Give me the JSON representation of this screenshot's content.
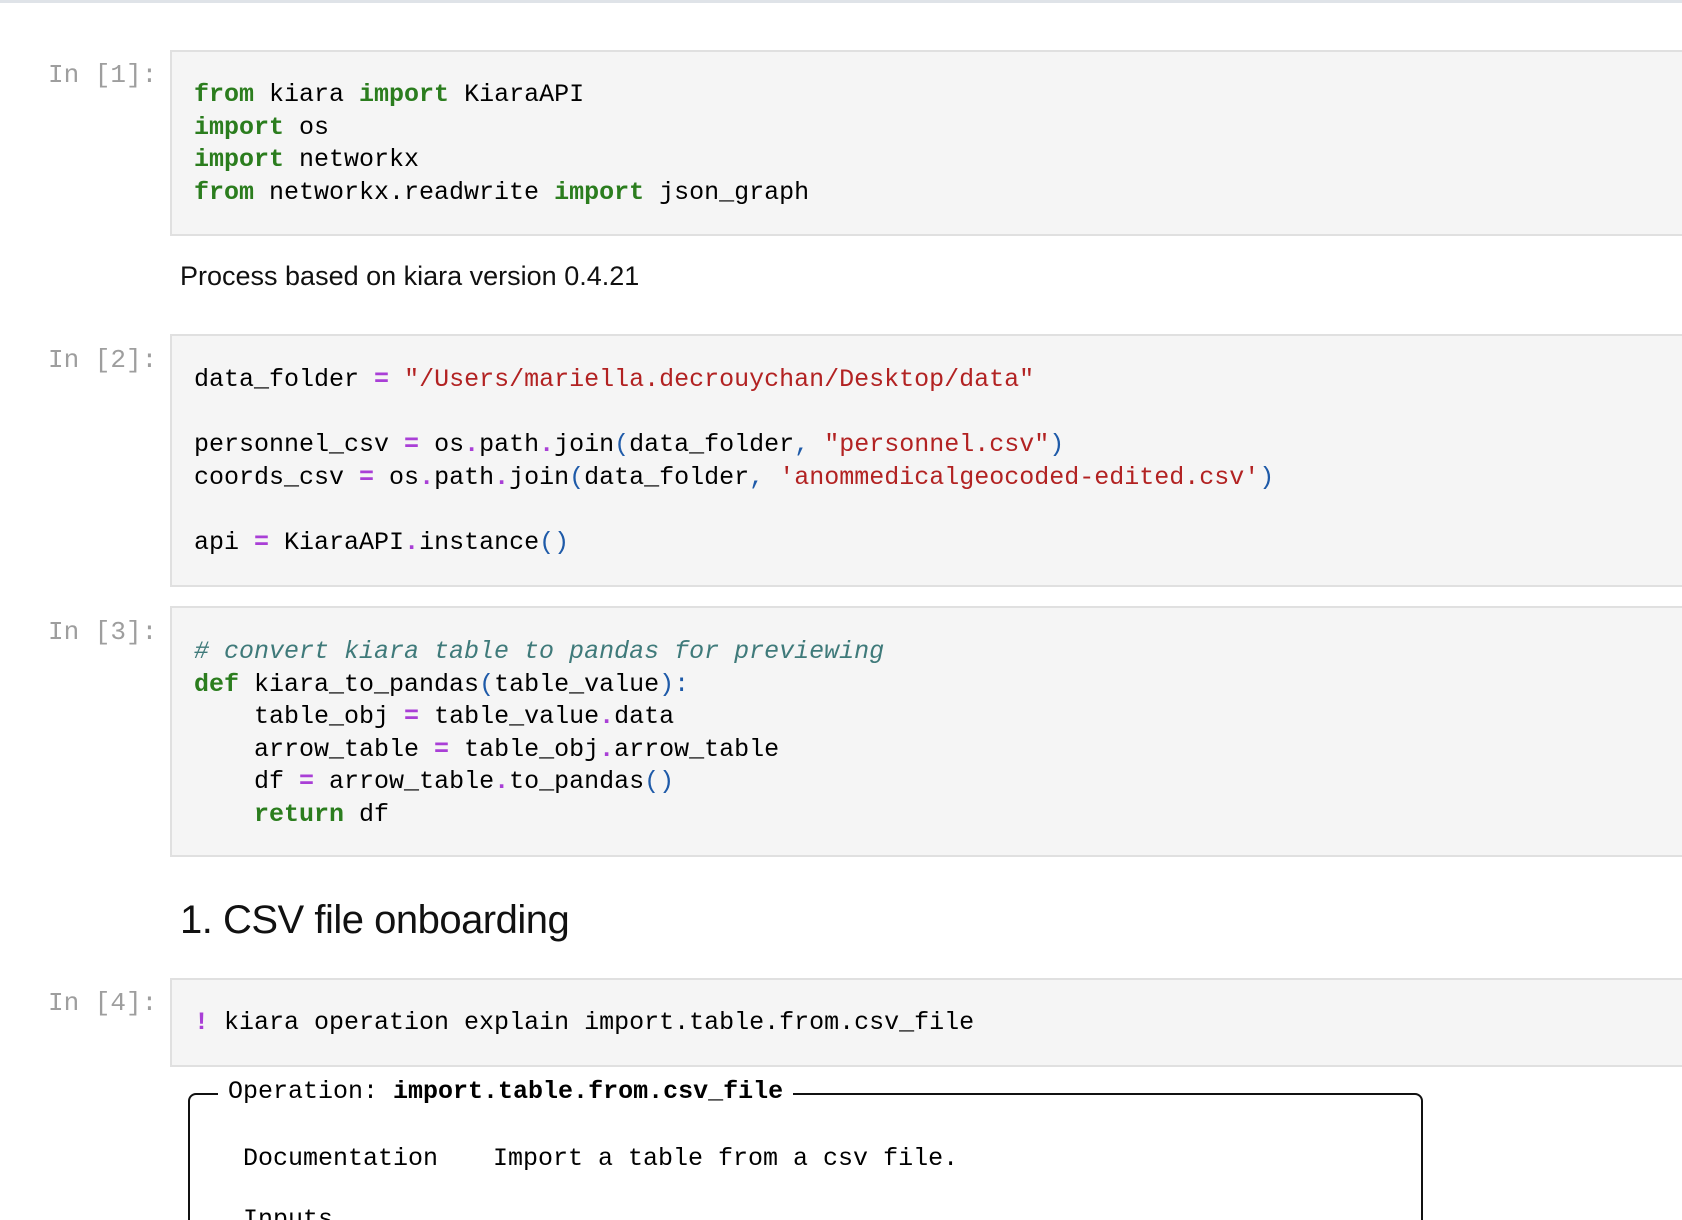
{
  "cells": [
    {
      "prompt": "In [1]:",
      "lines": [
        [
          [
            "kw",
            "from"
          ],
          [
            "t",
            " kiara "
          ],
          [
            "kw",
            "import"
          ],
          [
            "t",
            " KiaraAPI"
          ]
        ],
        [
          [
            "kw",
            "import"
          ],
          [
            "t",
            " os"
          ]
        ],
        [
          [
            "kw",
            "import"
          ],
          [
            "t",
            " networkx"
          ]
        ],
        [
          [
            "kw",
            "from"
          ],
          [
            "t",
            " networkx.readwrite "
          ],
          [
            "kw",
            "import"
          ],
          [
            "t",
            " json_graph"
          ]
        ]
      ]
    },
    {
      "prompt": "In [2]:",
      "lines": [
        [
          [
            "t",
            "data_folder "
          ],
          [
            "op",
            "="
          ],
          [
            "t",
            " "
          ],
          [
            "str",
            "\"/Users/mariella.decrouychan/Desktop/data\""
          ]
        ],
        [],
        [
          [
            "t",
            "personnel_csv "
          ],
          [
            "op",
            "="
          ],
          [
            "t",
            " os"
          ],
          [
            "op",
            "."
          ],
          [
            "t",
            "path"
          ],
          [
            "op",
            "."
          ],
          [
            "t",
            "join"
          ],
          [
            "br",
            "("
          ],
          [
            "t",
            "data_folder"
          ],
          [
            "br",
            ","
          ],
          [
            "t",
            " "
          ],
          [
            "str",
            "\"personnel.csv\""
          ],
          [
            "br",
            ")"
          ]
        ],
        [
          [
            "t",
            "coords_csv "
          ],
          [
            "op",
            "="
          ],
          [
            "t",
            " os"
          ],
          [
            "op",
            "."
          ],
          [
            "t",
            "path"
          ],
          [
            "op",
            "."
          ],
          [
            "t",
            "join"
          ],
          [
            "br",
            "("
          ],
          [
            "t",
            "data_folder"
          ],
          [
            "br",
            ","
          ],
          [
            "t",
            " "
          ],
          [
            "str",
            "'anommedicalgeocoded-edited.csv'"
          ],
          [
            "br",
            ")"
          ]
        ],
        [],
        [
          [
            "t",
            "api "
          ],
          [
            "op",
            "="
          ],
          [
            "t",
            " KiaraAPI"
          ],
          [
            "op",
            "."
          ],
          [
            "t",
            "instance"
          ],
          [
            "br",
            "()"
          ]
        ]
      ]
    },
    {
      "prompt": "In [3]:",
      "lines": [
        [
          [
            "cm",
            "# convert kiara table to pandas for previewing"
          ]
        ],
        [
          [
            "kw",
            "def"
          ],
          [
            "t",
            " kiara_to_pandas"
          ],
          [
            "br",
            "("
          ],
          [
            "t",
            "table_value"
          ],
          [
            "br",
            "):"
          ]
        ],
        [
          [
            "t",
            "    table_obj "
          ],
          [
            "op",
            "="
          ],
          [
            "t",
            " table_value"
          ],
          [
            "op",
            "."
          ],
          [
            "t",
            "data"
          ]
        ],
        [
          [
            "t",
            "    arrow_table "
          ],
          [
            "op",
            "="
          ],
          [
            "t",
            " table_obj"
          ],
          [
            "op",
            "."
          ],
          [
            "t",
            "arrow_table"
          ]
        ],
        [
          [
            "t",
            "    df "
          ],
          [
            "op",
            "="
          ],
          [
            "t",
            " arrow_table"
          ],
          [
            "op",
            "."
          ],
          [
            "t",
            "to_pandas"
          ],
          [
            "br",
            "()"
          ]
        ],
        [
          [
            "t",
            "    "
          ],
          [
            "kw",
            "return"
          ],
          [
            "t",
            " df"
          ]
        ]
      ]
    },
    {
      "prompt": "In [4]:",
      "lines": [
        [
          [
            "op",
            "!"
          ],
          [
            "t",
            " kiara operation explain import.table.from.csv_file"
          ]
        ]
      ]
    }
  ],
  "output1": "Process based on kiara version 0.4.21",
  "section_heading": "1. CSV file onboarding",
  "operation_box": {
    "title_prefix": "Operation: ",
    "title_name": "import.table.from.csv_file",
    "doc_label": "Documentation",
    "doc_value": "Import a table from a csv file.",
    "inputs_label": "Inputs"
  }
}
